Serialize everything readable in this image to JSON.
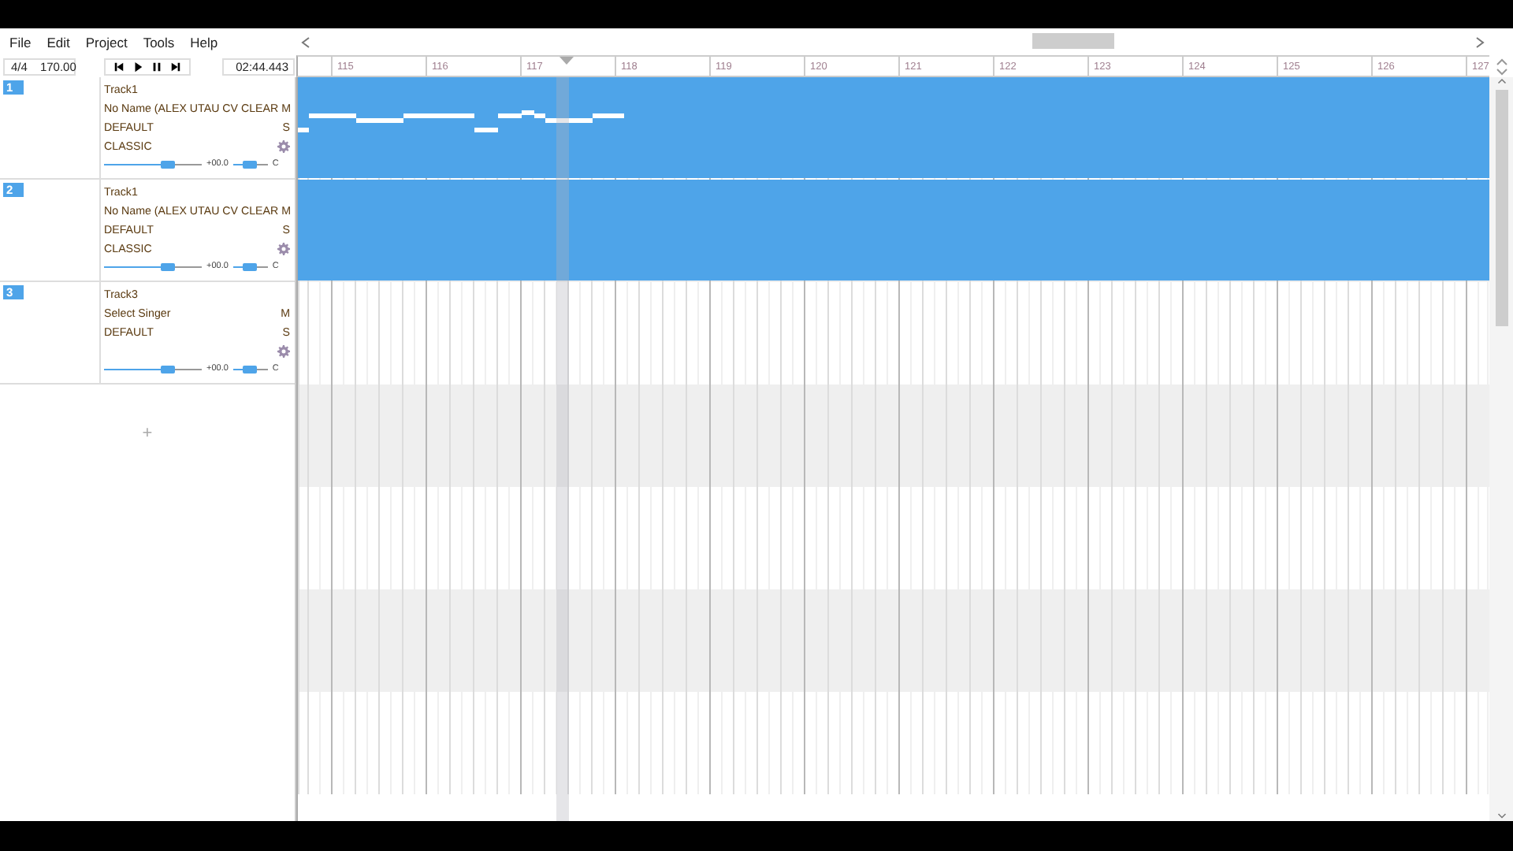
{
  "menu": [
    {
      "label": "File"
    },
    {
      "label": "Edit"
    },
    {
      "label": "Project"
    },
    {
      "label": "Tools"
    },
    {
      "label": "Help"
    }
  ],
  "toolbar": {
    "time_signature": "4/4",
    "tempo": "170.00",
    "time": "02:44.443"
  },
  "ruler": {
    "bars": [
      "115",
      "116",
      "117",
      "118",
      "119",
      "120",
      "121",
      "122",
      "123",
      "124",
      "125",
      "126",
      "127"
    ]
  },
  "tracks": [
    {
      "number": "1",
      "name": "Track1",
      "singer": "No Name (ALEX UTAU CV CLEAR",
      "mute": "M",
      "solo": "S",
      "phonemizer": "DEFAULT",
      "renderer": "CLASSIC",
      "volume": {
        "level": 0.65,
        "reading": "+00.0"
      },
      "pan": {
        "level": 0.5,
        "reading": "C"
      },
      "part": {
        "kind": "notes"
      }
    },
    {
      "number": "2",
      "name": "Track1",
      "singer": "No Name (ALEX UTAU CV CLEAR",
      "mute": "M",
      "solo": "S",
      "phonemizer": "DEFAULT",
      "renderer": "CLASSIC",
      "volume": {
        "level": 0.65,
        "reading": "+00.0"
      },
      "pan": {
        "level": 0.5,
        "reading": "C"
      },
      "part": {
        "kind": "empty"
      }
    },
    {
      "number": "3",
      "name": "Track3",
      "singer": "Select Singer",
      "mute": "M",
      "solo": "S",
      "phonemizer": "DEFAULT",
      "volume": {
        "level": 0.65,
        "reading": "+00.0"
      },
      "pan": {
        "level": 0.5,
        "reading": "C"
      }
    }
  ],
  "add_track": "+"
}
